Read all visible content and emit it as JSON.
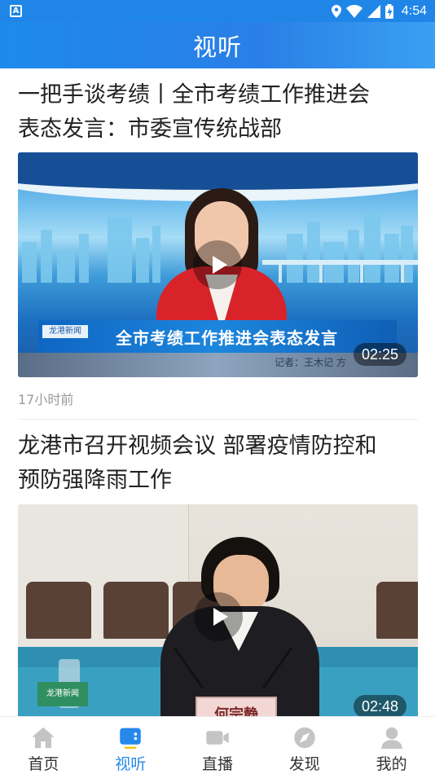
{
  "status_bar": {
    "time": "4:54",
    "notification_icon": "A"
  },
  "header": {
    "title": "视听"
  },
  "articles": [
    {
      "title": "一把手谈考绩丨全市考绩工作推进会\n表态发言：市委宣传统战部",
      "video": {
        "banner_text": "全市考绩工作推进会表态发言",
        "logo_text": "龙港新闻",
        "caption": "记者：王木记 方",
        "duration": "02:25"
      },
      "time": "17小时前"
    },
    {
      "title": "龙港市召开视频会议 部署疫情防控和\n预防强降雨工作",
      "video": {
        "logo_text": "龙港新闻",
        "nameplate": "何宗静",
        "duration": "02:48"
      }
    }
  ],
  "tabbar": {
    "items": [
      {
        "label": "首页",
        "icon": "home-icon",
        "active": false
      },
      {
        "label": "视听",
        "icon": "media-icon",
        "active": true
      },
      {
        "label": "直播",
        "icon": "video-camera-icon",
        "active": false
      },
      {
        "label": "发现",
        "icon": "compass-icon",
        "active": false
      },
      {
        "label": "我的",
        "icon": "user-icon",
        "active": false
      }
    ],
    "active_color": "#2588ea",
    "inactive_icon_color": "#c4c4c4"
  },
  "colors": {
    "header_bg": "#2a7fe6",
    "status_bar_bg": "#1f86e8"
  }
}
